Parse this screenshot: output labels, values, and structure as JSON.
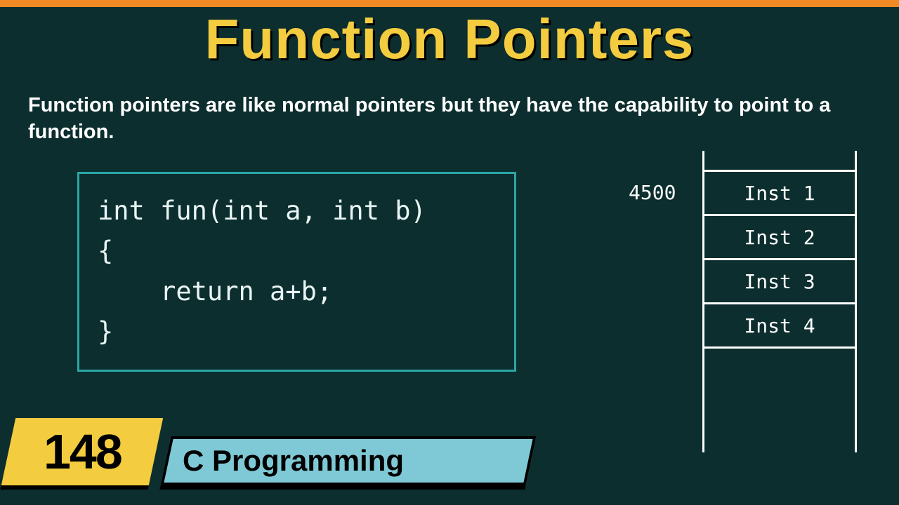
{
  "title": "Function Pointers",
  "description": "Function pointers are like normal pointers but they have the capability to point to a function.",
  "code": "int fun(int a, int b)\n{\n    return a+b;\n}",
  "memory": {
    "address": "4500",
    "cells": [
      "Inst 1",
      "Inst 2",
      "Inst 3",
      "Inst 4"
    ]
  },
  "banner": {
    "number": "148",
    "topic": "C Programming"
  }
}
